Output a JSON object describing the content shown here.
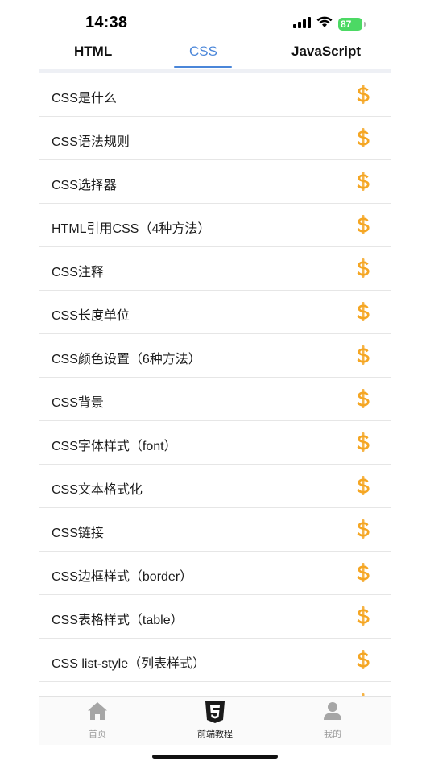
{
  "status_bar": {
    "time": "14:38",
    "battery": "87"
  },
  "tabs": [
    {
      "label": "HTML",
      "active": false
    },
    {
      "label": "CSS",
      "active": true
    },
    {
      "label": "JavaScript",
      "active": false
    }
  ],
  "colors": {
    "accent": "#4a86d9",
    "coin": "#f5a623",
    "battery": "#4cd964"
  },
  "list": {
    "icon": "dollar-coin-icon",
    "items": [
      "CSS是什么",
      "CSS语法规则",
      "CSS选择器",
      "HTML引用CSS（4种方法）",
      "CSS注释",
      "CSS长度单位",
      "CSS颜色设置（6种方法）",
      "CSS背景",
      "CSS字体样式（font）",
      "CSS文本格式化",
      "CSS链接",
      "CSS边框样式（border）",
      "CSS表格样式（table）",
      "CSS list-style（列表样式）",
      ""
    ]
  },
  "bottom_nav": [
    {
      "label": "首页",
      "icon": "home-icon",
      "active": false
    },
    {
      "label": "前端教程",
      "icon": "html5-icon",
      "active": true
    },
    {
      "label": "我的",
      "icon": "person-icon",
      "active": false
    }
  ]
}
